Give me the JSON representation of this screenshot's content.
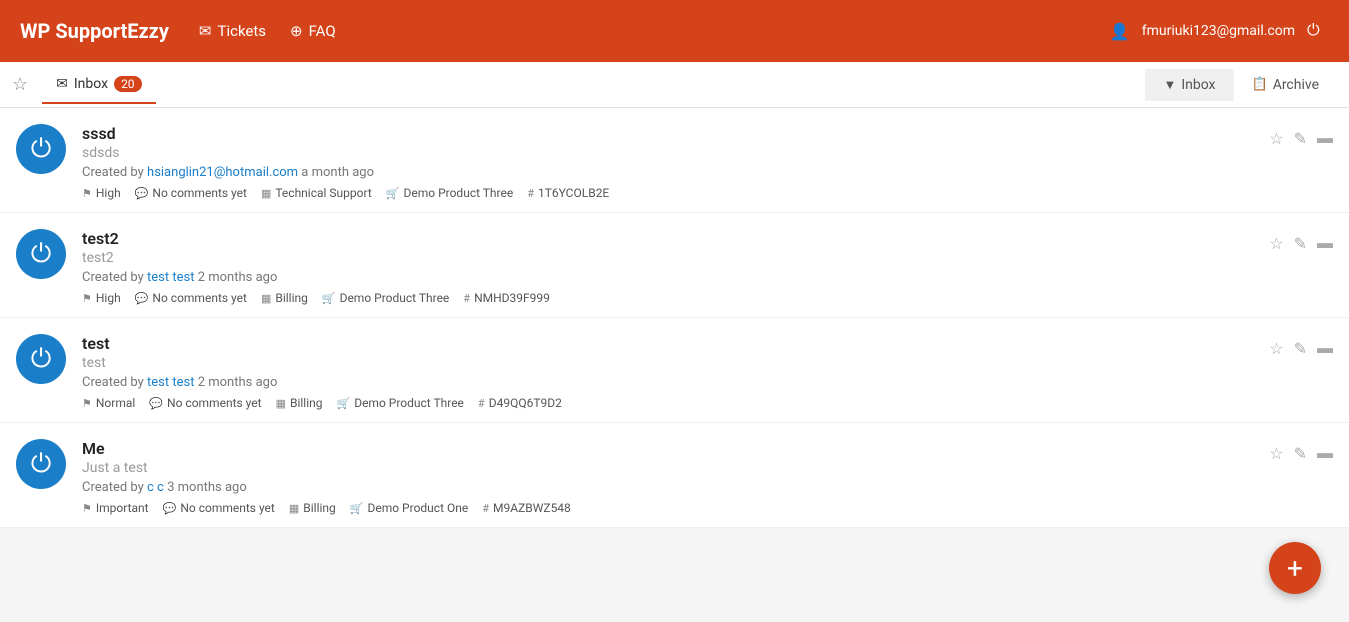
{
  "header": {
    "logo": "WP SupportEzzy",
    "nav": [
      {
        "icon": "✉",
        "label": "Tickets"
      },
      {
        "icon": "?",
        "label": "FAQ"
      }
    ],
    "user_email": "fmuriuki123@gmail.com",
    "power_icon": "⏻"
  },
  "subheader": {
    "star_icon": "★",
    "inbox_tab_label": "Inbox",
    "inbox_count": "20",
    "filter_tabs": [
      {
        "icon": "▼",
        "label": "Inbox",
        "active": true
      },
      {
        "icon": "📋",
        "label": "Archive",
        "active": false
      }
    ]
  },
  "tickets": [
    {
      "id": 1,
      "title": "sssd",
      "subtitle": "sdsds",
      "created_by_text": "Created by",
      "author": "hsianglin21@hotmail.com",
      "time_ago": "a month ago",
      "priority": "High",
      "comments": "No comments yet",
      "category": "Technical Support",
      "product": "Demo Product Three",
      "ticket_id": "1T6YCOLB2E"
    },
    {
      "id": 2,
      "title": "test2",
      "subtitle": "test2",
      "created_by_text": "Created by",
      "author": "test test",
      "time_ago": "2 months ago",
      "priority": "High",
      "comments": "No comments yet",
      "category": "Billing",
      "product": "Demo Product Three",
      "ticket_id": "NMHD39F999"
    },
    {
      "id": 3,
      "title": "test",
      "subtitle": "test",
      "created_by_text": "Created by",
      "author": "test test",
      "time_ago": "2 months ago",
      "priority": "Normal",
      "comments": "No comments yet",
      "category": "Billing",
      "product": "Demo Product Three",
      "ticket_id": "D49QQ6T9D2"
    },
    {
      "id": 4,
      "title": "Me",
      "subtitle": "Just a test",
      "created_by_text": "Created by",
      "author": "c c",
      "time_ago": "3 months ago",
      "priority": "Important",
      "comments": "No comments yet",
      "category": "Billing",
      "product": "Demo Product One",
      "ticket_id": "M9AZBWZ548"
    }
  ],
  "fab_icon": "+",
  "colors": {
    "accent": "#d4431a",
    "avatar_bg": "#1a7ec8",
    "link_color": "#1a7ec8"
  }
}
